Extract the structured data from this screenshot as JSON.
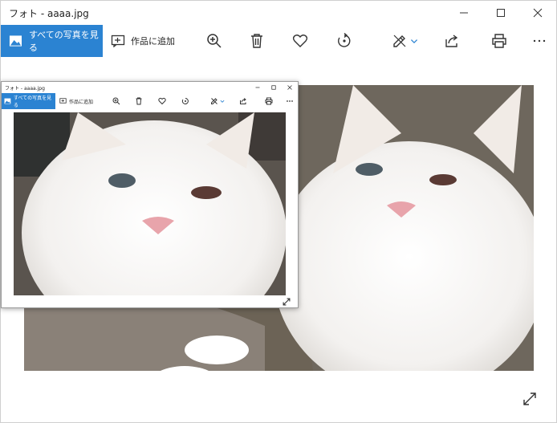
{
  "window": {
    "title": "フォト - aaaa.jpg"
  },
  "toolbar": {
    "all_photos_label": "すべての写真を見る",
    "add_to_label": "作品に追加"
  },
  "icons": [
    "image-icon",
    "add-to-creation-icon",
    "zoom-in-icon",
    "delete-icon",
    "heart-icon",
    "rotate-icon",
    "edit-create-icon",
    "chevron-down-icon",
    "share-icon",
    "print-icon",
    "more-icon",
    "expand-icon"
  ],
  "colors": {
    "accent": "#2b83d2",
    "window_bg": "#ffffff",
    "text": "#222222"
  },
  "mini_window": {
    "title": "フォト - aaaa.jpg",
    "all_photos_label": "すべての写真を見る",
    "add_to_label": "作品に追加"
  }
}
